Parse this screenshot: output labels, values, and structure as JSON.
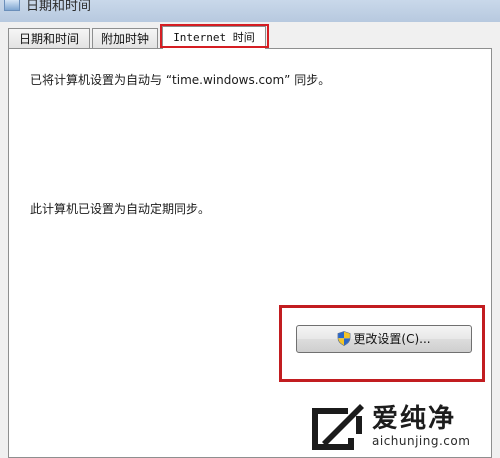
{
  "window": {
    "title": "日期和时间"
  },
  "tabs": [
    {
      "label": "日期和时间"
    },
    {
      "label": "附加时钟"
    },
    {
      "label": "Internet 时间"
    }
  ],
  "internet_time": {
    "sync_status": "已将计算机设置为自动与 “time.windows.com” 同步。",
    "schedule_status": "此计算机已设置为自动定期同步。",
    "change_button_label": "更改设置(C)...",
    "button_icon": "uac-shield-icon"
  },
  "annotations": {
    "highlight_color": "#d51e23"
  },
  "watermark": {
    "brand": "爱纯净",
    "url": "aichunjing.com"
  }
}
